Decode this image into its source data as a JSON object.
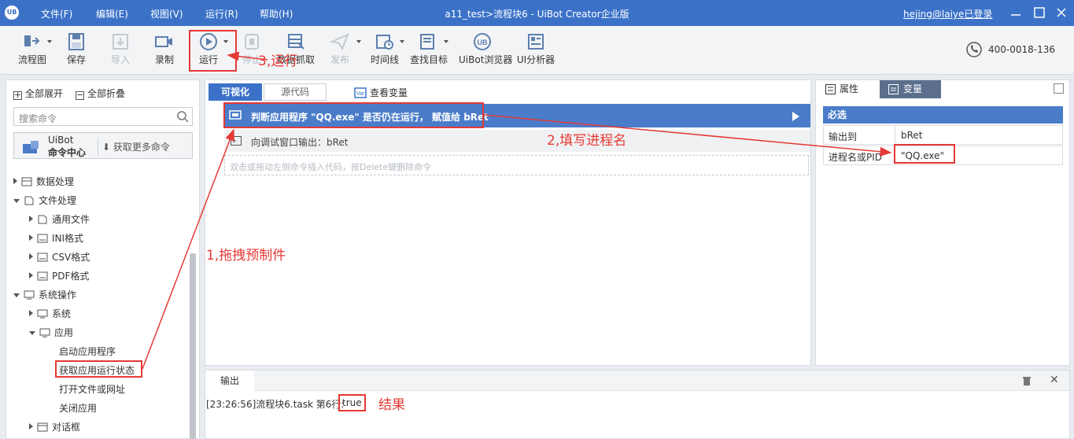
{
  "titlebar": {
    "logo_text": "UB",
    "menu": [
      "文件(F)",
      "编辑(E)",
      "视图(V)",
      "运行(R)",
      "帮助(H)"
    ],
    "window_title": "a11_test>流程块6 - UiBot Creator企业版",
    "user": "hejing@laiye已登录"
  },
  "toolbar": {
    "items": [
      {
        "label": "流程图",
        "icon": "flowchart-icon",
        "enabled": true
      },
      {
        "label": "保存",
        "icon": "save-icon",
        "enabled": true
      },
      {
        "label": "导入",
        "icon": "import-icon",
        "enabled": false
      },
      {
        "label": "录制",
        "icon": "record-icon",
        "enabled": true
      },
      {
        "label": "运行",
        "icon": "run-icon",
        "enabled": true
      },
      {
        "label": "停止",
        "icon": "stop-icon",
        "enabled": false
      },
      {
        "label": "数据抓取",
        "icon": "data-scrape-icon",
        "enabled": true
      },
      {
        "label": "发布",
        "icon": "publish-icon",
        "enabled": false
      },
      {
        "label": "时间线",
        "icon": "timeline-icon",
        "enabled": true
      },
      {
        "label": "查找目标",
        "icon": "find-target-icon",
        "enabled": true
      },
      {
        "label": "UiBot浏览器",
        "icon": "uibot-browser-icon",
        "enabled": true
      },
      {
        "label": "UI分析器",
        "icon": "ui-analyzer-icon",
        "enabled": true
      }
    ],
    "phone": "400-0018-136"
  },
  "left_panel": {
    "expand_all": "全部展开",
    "collapse_all": "全部折叠",
    "search_placeholder": "搜索命令",
    "command_center": {
      "title": "UiBot",
      "subtitle": "命令中心",
      "more": "获取更多命令"
    },
    "tree": [
      {
        "label": "数据处理",
        "level": 0,
        "state": "collapsed",
        "icon": "data-icon"
      },
      {
        "label": "文件处理",
        "level": 0,
        "state": "expanded",
        "icon": "file-icon"
      },
      {
        "label": "通用文件",
        "level": 1,
        "state": "collapsed",
        "icon": "general-file-icon"
      },
      {
        "label": "INI格式",
        "level": 1,
        "state": "collapsed",
        "icon": "ini-icon"
      },
      {
        "label": "CSV格式",
        "level": 1,
        "state": "collapsed",
        "icon": "csv-icon"
      },
      {
        "label": "PDF格式",
        "level": 1,
        "state": "collapsed",
        "icon": "pdf-icon"
      },
      {
        "label": "系统操作",
        "level": 0,
        "state": "expanded",
        "icon": "system-icon"
      },
      {
        "label": "系统",
        "level": 1,
        "state": "collapsed",
        "icon": "system-sub-icon"
      },
      {
        "label": "应用",
        "level": 1,
        "state": "expanded",
        "icon": "app-icon"
      },
      {
        "label": "启动应用程序",
        "level": 2,
        "state": "leaf"
      },
      {
        "label": "获取应用运行状态",
        "level": 2,
        "state": "leaf"
      },
      {
        "label": "打开文件或网址",
        "level": 2,
        "state": "leaf"
      },
      {
        "label": "关闭应用",
        "level": 2,
        "state": "leaf"
      },
      {
        "label": "对话框",
        "level": 1,
        "state": "collapsed",
        "icon": "dialog-icon"
      }
    ]
  },
  "editor": {
    "tab_visual": "可视化",
    "tab_source": "源代码",
    "view_vars": "查看变量",
    "statements": [
      "判断应用程序 \"QQ.exe\" 是否仍在运行， 赋值给 bRet",
      "向调试窗口输出：bRet"
    ],
    "drop_hint": "双击或拖动左侧命令插入代码，按Delete键删除命令"
  },
  "right_panel": {
    "tab_attr": "属性",
    "tab_var": "变量",
    "section": "必选",
    "rows": [
      {
        "key": "输出到",
        "value": "bRet"
      },
      {
        "key": "进程名或PID",
        "value": "\"QQ.exe\""
      }
    ]
  },
  "output": {
    "tab": "输出",
    "line_prefix": "[23:26:56]流程块6.task 第6行:",
    "value": "true"
  },
  "annotations": {
    "drag": "1,拖拽预制件",
    "fill": "2,填写进程名",
    "run": "3,运行",
    "result": "结果",
    "color": "#e53935"
  },
  "colors": {
    "brand": "#3b72c8",
    "statement": "#4a7cc9",
    "annotation": "#e53935"
  }
}
